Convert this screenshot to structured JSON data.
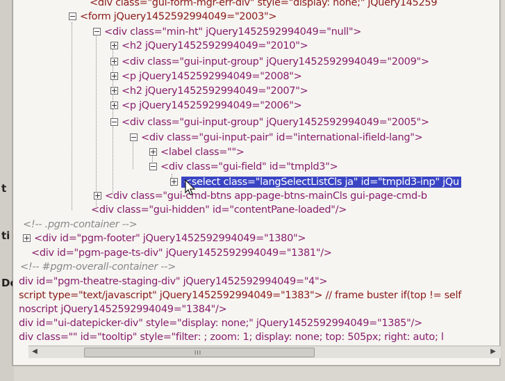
{
  "left_fragments": [
    "t",
    "ti",
    "De"
  ],
  "tree_lines": [
    {
      "t": "<div class=\"gui-form-mgr-err-div\" style=\"display: none;\" jQuery145259"
    },
    {
      "t": "<form jQuery1452592994049=\"2003\">"
    },
    {
      "t": "<div class=\"min-ht\" jQuery1452592994049=\"null\">"
    },
    {
      "t": "<h2 jQuery1452592994049=\"2010\">"
    },
    {
      "t": "<div class=\"gui-input-group\" jQuery1452592994049=\"2009\">"
    },
    {
      "t": "<p jQuery1452592994049=\"2008\">"
    },
    {
      "t": "<h2 jQuery1452592994049=\"2007\">"
    },
    {
      "t": "<p jQuery1452592994049=\"2006\">"
    },
    {
      "t": "<div class=\"gui-input-group\" jQuery1452592994049=\"2005\">"
    },
    {
      "t": "<div class=\"gui-input-pair\" id=\"international-ifield-lang\">"
    },
    {
      "t": "<label class=\"\">"
    },
    {
      "t": "<div class=\"gui-field\" id=\"tmpld3\">"
    },
    {
      "t": "<select class=\"langSelectListCls ja\" id=\"tmpld3-inp\" jQu"
    },
    {
      "t": "<div class=\"gui-cmd-btns app-page-btns-mainCls gui-page-cmd-b"
    },
    {
      "t": "<div class=\"gui-hidden\" id=\"contentPane-loaded\"/>"
    },
    {
      "t": "<!-- .pgm-container -->"
    },
    {
      "t": "<div id=\"pgm-footer\" jQuery1452592994049=\"1380\">"
    },
    {
      "t": "<div id=\"pgm-page-ts-div\" jQuery1452592994049=\"1381\"/>"
    },
    {
      "t": "<!-- #pgm-overall-container -->"
    },
    {
      "t": "div id=\"pgm-theatre-staging-div\" jQuery1452592994049=\"4\">"
    },
    {
      "t": "script type=\"text/javascript\" jQuery1452592994049=\"1383\"> // frame buster if(top != self"
    },
    {
      "t": "noscript jQuery1452592994049=\"1384\"/>"
    },
    {
      "t": "div id=\"ui-datepicker-div\" style=\"display: none;\" jQuery1452592994049=\"1385\"/>"
    },
    {
      "t": "div class=\"\" id=\"tooltip\" style=\"filter: ; zoom: 1; display: none; top: 505px; right: auto; l"
    }
  ],
  "scrollbar": {
    "grip": "III"
  },
  "colors": {
    "selection": "#3a45c4",
    "tag": "#871d6c",
    "value": "#2d2da8",
    "attr": "#b5451e"
  }
}
